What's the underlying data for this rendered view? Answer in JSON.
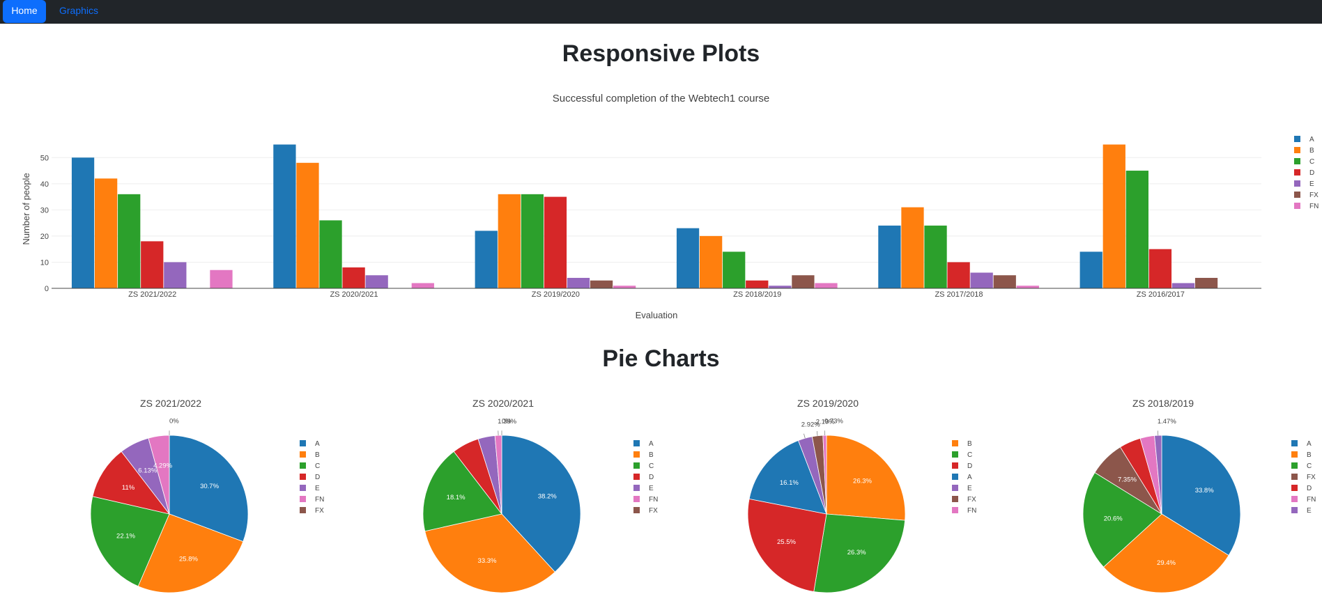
{
  "nav": {
    "home_label": "Home",
    "graphics_label": "Graphics"
  },
  "page": {
    "title": "Responsive Plots",
    "pie_section_title": "Pie Charts"
  },
  "colors": {
    "A": "#1f77b4",
    "B": "#ff7f0e",
    "C": "#2ca02c",
    "D": "#d62728",
    "E": "#9467bd",
    "FX": "#8c564b",
    "FN": "#e377c2"
  },
  "chart_data": [
    {
      "type": "bar",
      "title": "Successful completion of the Webtech1 course",
      "xlabel": "Evaluation",
      "ylabel": "Number of people",
      "categories": [
        "ZS 2021/2022",
        "ZS 2020/2021",
        "ZS 2019/2020",
        "ZS 2018/2019",
        "ZS 2017/2018",
        "ZS 2016/2017"
      ],
      "yticks": [
        0,
        10,
        20,
        30,
        40,
        50
      ],
      "ylim": [
        0,
        57
      ],
      "legend": "right",
      "series": [
        {
          "name": "A",
          "values": [
            50,
            55,
            22,
            23,
            24,
            14
          ]
        },
        {
          "name": "B",
          "values": [
            42,
            48,
            36,
            20,
            31,
            55
          ]
        },
        {
          "name": "C",
          "values": [
            36,
            26,
            36,
            14,
            24,
            45
          ]
        },
        {
          "name": "D",
          "values": [
            18,
            8,
            35,
            3,
            10,
            15
          ]
        },
        {
          "name": "E",
          "values": [
            10,
            5,
            4,
            1,
            6,
            2
          ]
        },
        {
          "name": "FX",
          "values": [
            0,
            0,
            3,
            5,
            5,
            4
          ]
        },
        {
          "name": "FN",
          "values": [
            7,
            2,
            1,
            2,
            1,
            0
          ]
        }
      ]
    },
    {
      "type": "pie",
      "title": "ZS 2021/2022",
      "labels": [
        "A",
        "B",
        "C",
        "D",
        "E",
        "FN",
        "FX"
      ],
      "values": [
        30.7,
        25.8,
        22.1,
        11,
        6.13,
        4.29,
        0
      ],
      "text": [
        "30.7%",
        "25.8%",
        "22.1%",
        "11%",
        "6.13%",
        "4.29%",
        "0%"
      ]
    },
    {
      "type": "pie",
      "title": "ZS 2020/2021",
      "labels": [
        "A",
        "B",
        "C",
        "D",
        "E",
        "FN",
        "FX"
      ],
      "values": [
        38.2,
        33.3,
        18.1,
        5.56,
        3.47,
        1.39,
        0
      ],
      "text": [
        "38.2%",
        "33.3%",
        "18.1%",
        "",
        "",
        "1.39%",
        "0%"
      ]
    },
    {
      "type": "pie",
      "title": "ZS 2019/2020",
      "labels": [
        "B",
        "C",
        "D",
        "A",
        "E",
        "FX",
        "FN"
      ],
      "values": [
        26.3,
        26.3,
        25.5,
        16.1,
        2.92,
        2.19,
        0.73
      ],
      "text": [
        "26.3%",
        "26.3%",
        "25.5%",
        "16.1%",
        "2.92%",
        "2.19%",
        "0.73%"
      ]
    },
    {
      "type": "pie",
      "title": "ZS 2018/2019",
      "labels": [
        "A",
        "B",
        "C",
        "FX",
        "D",
        "FN",
        "E"
      ],
      "values": [
        33.8,
        29.4,
        20.6,
        7.35,
        4.41,
        2.94,
        1.47
      ],
      "text": [
        "33.8%",
        "29.4%",
        "20.6%",
        "7.35%",
        "",
        "",
        "1.47%"
      ]
    }
  ]
}
